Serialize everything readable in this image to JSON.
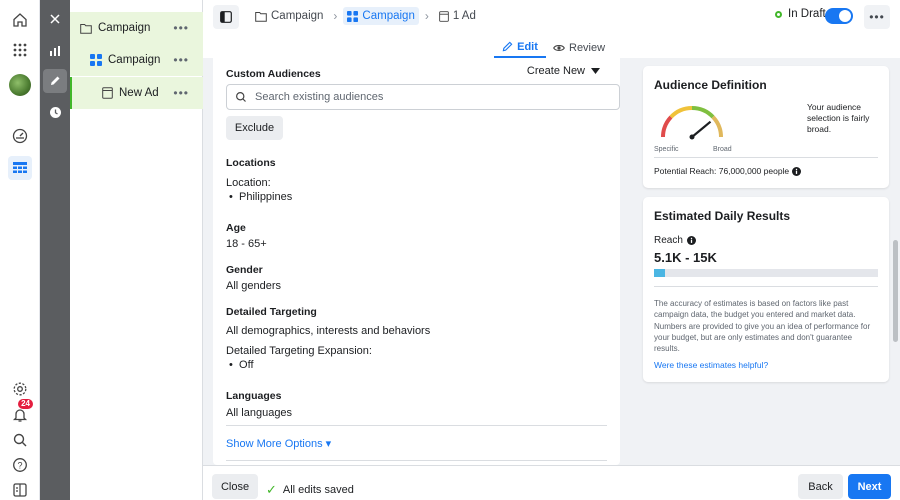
{
  "rail": {
    "icons": [
      "home-icon",
      "apps-grid-icon",
      "profile-avatar",
      "dashboard-gauge-icon",
      "ads-manager-table-icon",
      "settings-icon",
      "notifications-bell-icon",
      "search-icon",
      "help-icon",
      "panel-icon"
    ],
    "notification_count": "24"
  },
  "toolstrip": {
    "icons": [
      "close-icon",
      "chart-icon",
      "edit-pencil-icon",
      "clock-icon"
    ]
  },
  "tree": {
    "items": [
      {
        "label": "Campaign",
        "type": "campaign"
      },
      {
        "label": "Campaign",
        "type": "ad-set"
      },
      {
        "label": "New Ad",
        "type": "ad"
      }
    ],
    "more": "•••"
  },
  "header": {
    "breadcrumbs": [
      {
        "label": "Campaign"
      },
      {
        "label": "Campaign"
      },
      {
        "label": "1 Ad"
      }
    ],
    "status": "In Draft",
    "more": "•••"
  },
  "modes": {
    "edit": "Edit",
    "review": "Review"
  },
  "form": {
    "custom_audiences": {
      "title": "Custom Audiences",
      "create_new": "Create New",
      "search_placeholder": "Search existing audiences",
      "exclude": "Exclude"
    },
    "locations": {
      "title": "Locations",
      "label": "Location:",
      "value": "Philippines"
    },
    "age": {
      "title": "Age",
      "value": "18 - 65+"
    },
    "gender": {
      "title": "Gender",
      "value": "All genders"
    },
    "detailed_targeting": {
      "title": "Detailed Targeting",
      "value": "All demographics, interests and behaviors",
      "expansion_label": "Detailed Targeting Expansion:",
      "expansion_value": "Off"
    },
    "languages": {
      "title": "Languages",
      "value": "All languages"
    },
    "show_more": "Show More Options ▾"
  },
  "audience_definition": {
    "title": "Audience Definition",
    "description": "Your audience selection is fairly broad.",
    "gauge_left": "Specific",
    "gauge_right": "Broad",
    "gauge_level": 0.78,
    "reach": "Potential Reach: 76,000,000 people"
  },
  "daily_results": {
    "title": "Estimated Daily Results",
    "reach_label": "Reach",
    "reach_value": "5.1K - 15K",
    "reach_fill": 0.05,
    "disclaimer": "The accuracy of estimates is based on factors like past campaign data, the budget you entered and market data. Numbers are provided to give you an idea of performance for your budget, but are only estimates and don't guarantee results.",
    "helpful_link": "Were these estimates helpful?"
  },
  "footer": {
    "close": "Close",
    "saved": "All edits saved",
    "back": "Back",
    "next": "Next"
  },
  "colors": {
    "accent": "#1877f2",
    "success": "#42b72a",
    "tree_highlight": "#eaf6dd",
    "toolstrip": "#5b5d60",
    "badge": "#e41e3f"
  }
}
